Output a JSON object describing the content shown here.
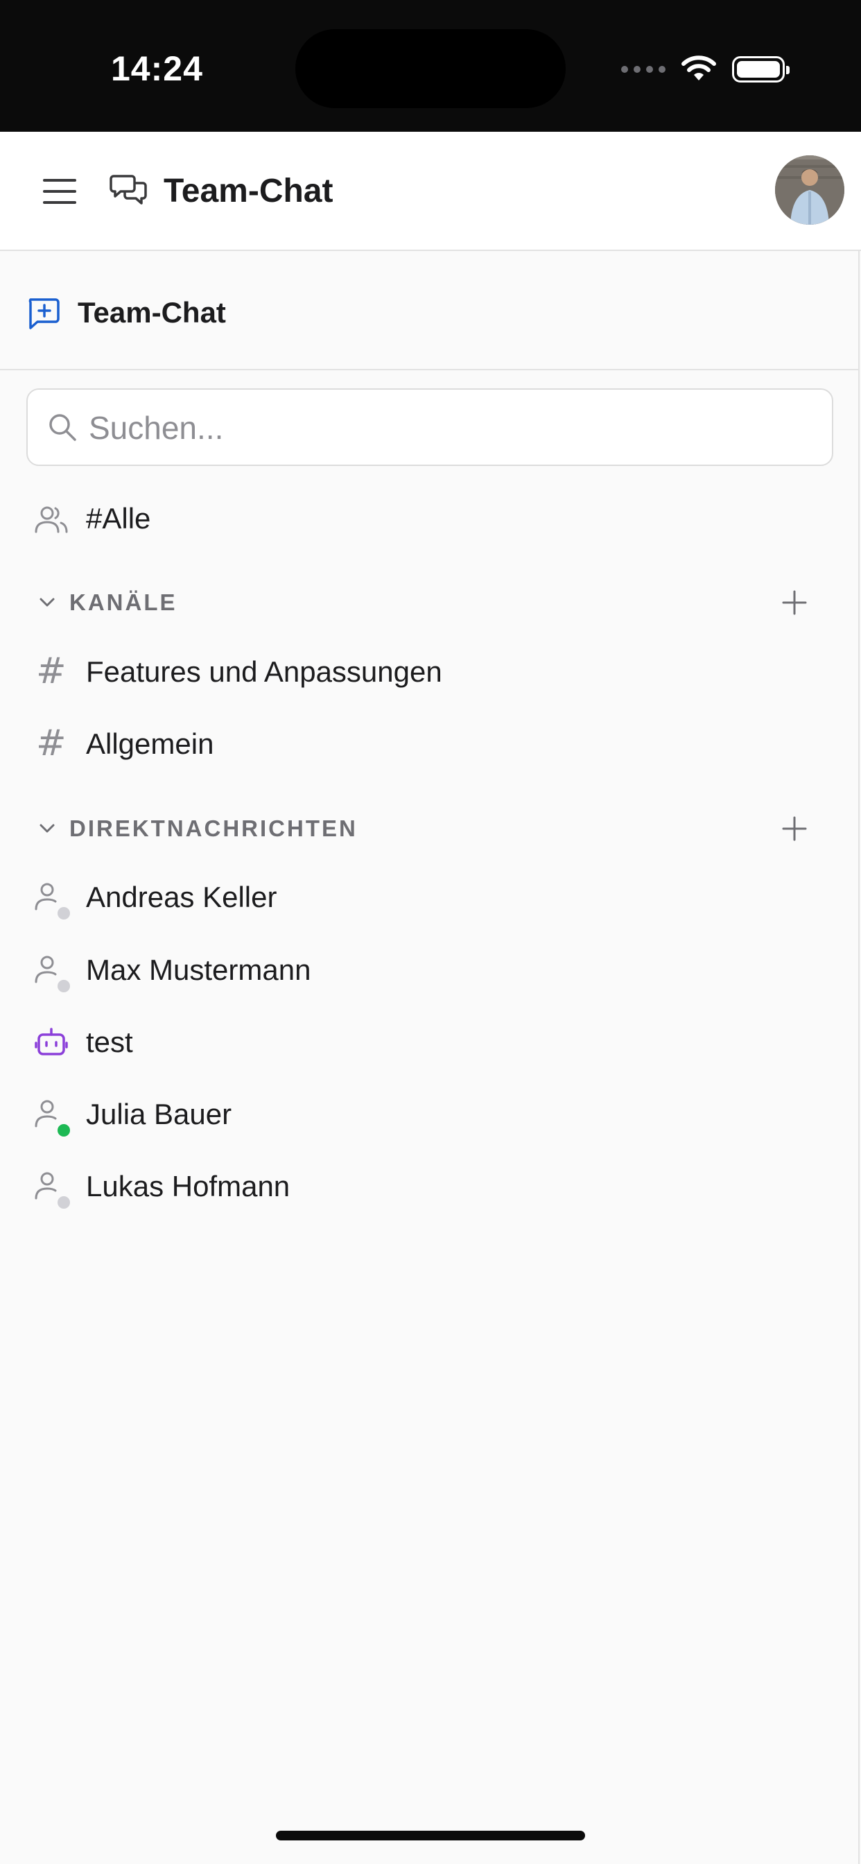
{
  "status_bar": {
    "time": "14:24"
  },
  "header": {
    "title": "Team-Chat"
  },
  "section": {
    "title": "Team-Chat"
  },
  "search": {
    "placeholder": "Suchen..."
  },
  "all_item": {
    "label": "#Alle"
  },
  "channels": {
    "label": "KANÄLE",
    "items": [
      {
        "label": "Features und Anpassungen"
      },
      {
        "label": "Allgemein"
      }
    ]
  },
  "direct_messages": {
    "label": "DIREKTNACHRICHTEN",
    "items": [
      {
        "label": "Andreas Keller",
        "icon": "user-icon",
        "presence": "offline"
      },
      {
        "label": "Max Mustermann",
        "icon": "user-icon",
        "presence": "offline"
      },
      {
        "label": "test",
        "icon": "bot-icon",
        "presence": "none"
      },
      {
        "label": "Julia Bauer",
        "icon": "user-icon",
        "presence": "online"
      },
      {
        "label": "Lukas Hofmann",
        "icon": "user-icon",
        "presence": "offline"
      }
    ]
  },
  "colors": {
    "accent": "#1a5fd0",
    "bot": "#8b3fd9",
    "online": "#1db954",
    "offline": "#d1d1d6",
    "muted": "#8e8e93"
  }
}
